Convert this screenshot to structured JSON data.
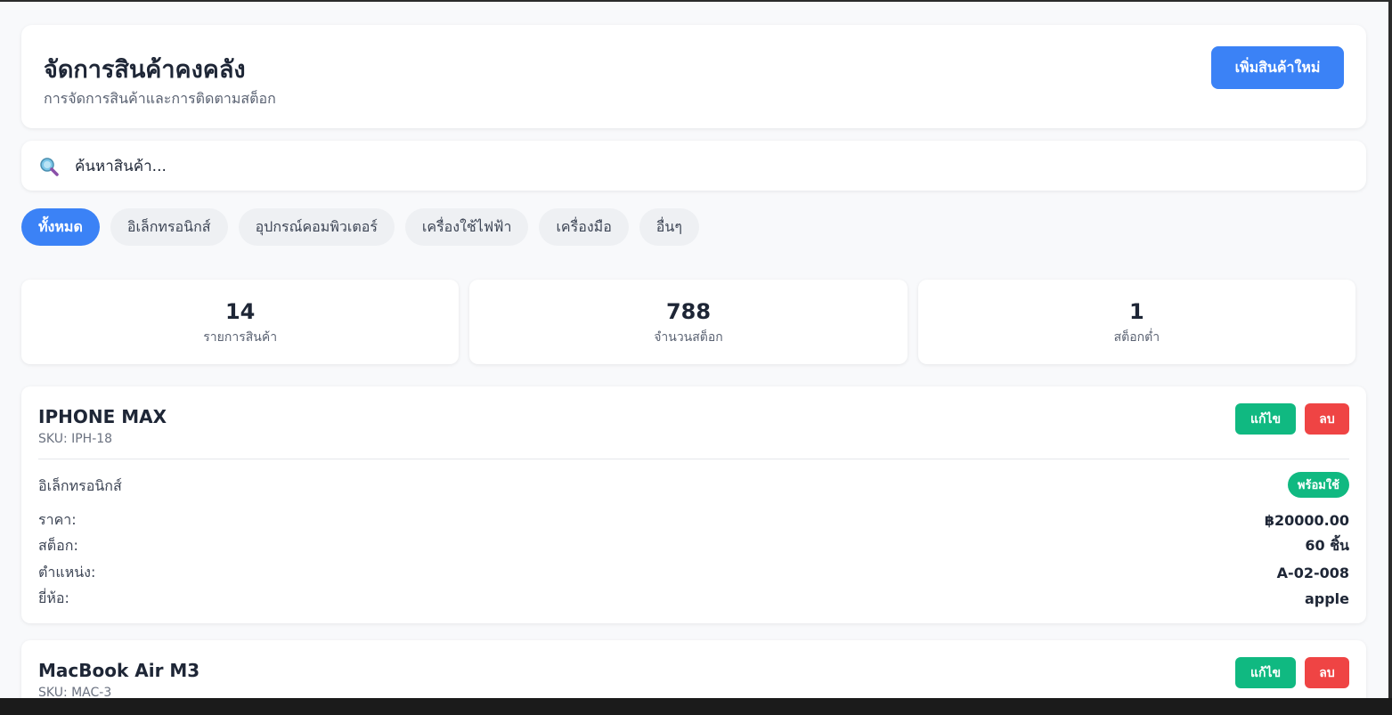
{
  "header": {
    "title": "จัดการสินค้าคงคลัง",
    "subtitle": "การจัดการสินค้าและการติดตามสต็อก",
    "add_button": "เพิ่มสินค้าใหม่"
  },
  "search": {
    "placeholder": "ค้นหาสินค้า...",
    "value": ""
  },
  "filters": [
    {
      "label": "ทั้งหมด",
      "active": true
    },
    {
      "label": "อิเล็กทรอนิกส์",
      "active": false
    },
    {
      "label": "อุปกรณ์คอมพิวเตอร์",
      "active": false
    },
    {
      "label": "เครื่องใช้ไฟฟ้า",
      "active": false
    },
    {
      "label": "เครื่องมือ",
      "active": false
    },
    {
      "label": "อื่นๆ",
      "active": false
    }
  ],
  "stats": [
    {
      "value": "14",
      "label": "รายการสินค้า"
    },
    {
      "value": "788",
      "label": "จำนวนสต็อก"
    },
    {
      "value": "1",
      "label": "สต็อกต่ำ"
    }
  ],
  "products": [
    {
      "name": "IPHONE MAX",
      "sku": "SKU: IPH-18",
      "edit_label": "แก้ไข",
      "delete_label": "ลบ",
      "category": "อิเล็กทรอนิกส์",
      "status": "พร้อมใช้",
      "details": [
        {
          "label": "ราคา:",
          "value": "฿20000.00"
        },
        {
          "label": "สต็อก:",
          "value": "60 ชิ้น"
        },
        {
          "label": "ตำแหน่ง:",
          "value": "A-02-008"
        },
        {
          "label": "ยี่ห้อ:",
          "value": "apple"
        }
      ]
    },
    {
      "name": "MacBook Air M3",
      "sku": "SKU: MAC-3",
      "edit_label": "แก้ไข",
      "delete_label": "ลบ"
    }
  ],
  "colors": {
    "primary": "#3b82f6",
    "success": "#10b981",
    "danger": "#ef4444",
    "background": "#f8f9fb"
  },
  "icons": {
    "search": "magnifier-icon"
  }
}
